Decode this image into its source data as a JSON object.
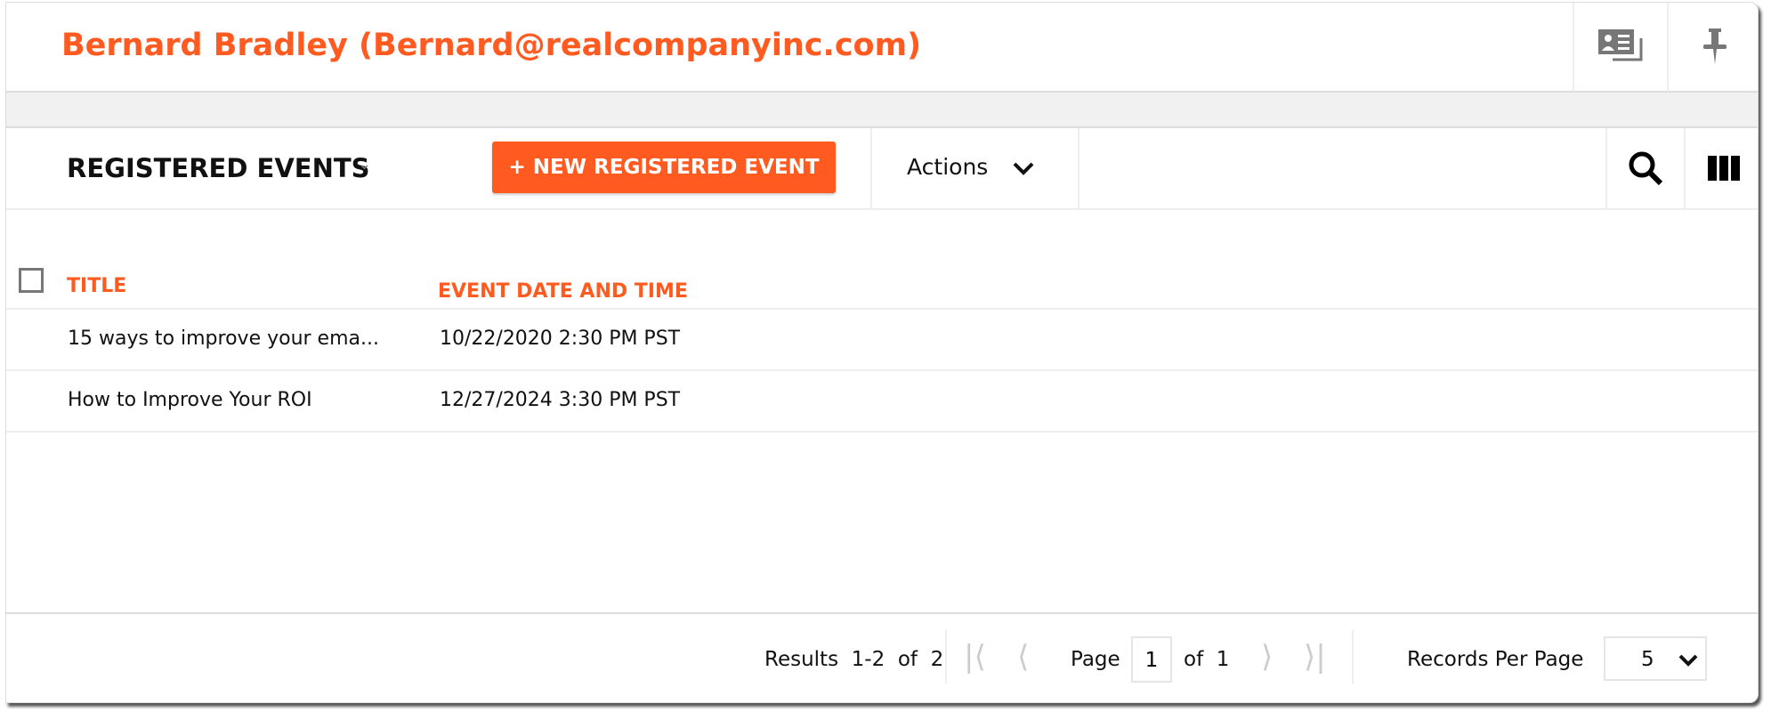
{
  "header": {
    "contact_name": "Bernard Bradley (Bernard@realcompanyinc.com)",
    "icons": [
      "contact-card-icon",
      "pin-icon"
    ]
  },
  "toolbar": {
    "title": "REGISTERED EVENTS",
    "new_button": "+ NEW REGISTERED EVENT",
    "actions_label": "Actions",
    "icons": [
      "search-icon",
      "columns-icon"
    ]
  },
  "table": {
    "columns": [
      "TITLE",
      "EVENT DATE AND TIME"
    ],
    "rows": [
      {
        "title": "15 ways to improve your ema...",
        "date": "10/22/2020 2:30 PM PST"
      },
      {
        "title": "How to Improve Your ROI",
        "date": "12/27/2024 3:30 PM PST"
      }
    ]
  },
  "footer": {
    "results": "Results  1-2  of  2",
    "page_label": "Page",
    "page_value": "1",
    "of_label": "of  1",
    "records_label": "Records Per Page",
    "records_value": "5"
  },
  "colors": {
    "accent": "#ff5a1f"
  }
}
